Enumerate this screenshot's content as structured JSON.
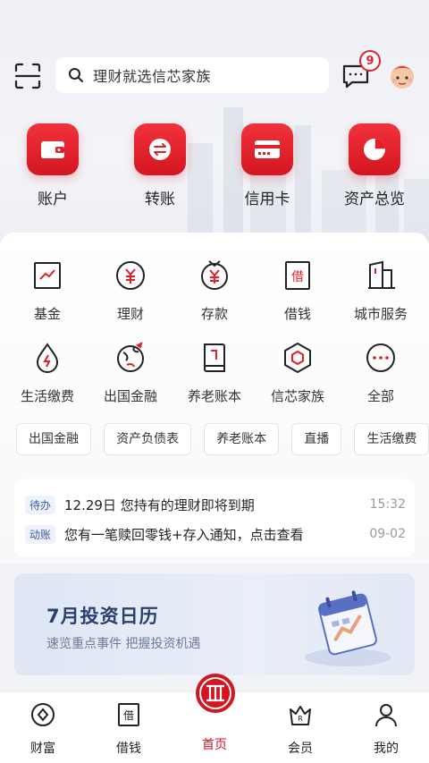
{
  "search": {
    "placeholder": "理财就选信芯家族"
  },
  "notifications": {
    "badge_count": "9"
  },
  "primary_actions": [
    {
      "label": "账户",
      "icon": "wallet-icon"
    },
    {
      "label": "转账",
      "icon": "transfer-icon"
    },
    {
      "label": "信用卡",
      "icon": "credit-card-icon"
    },
    {
      "label": "资产总览",
      "icon": "pie-chart-icon"
    }
  ],
  "services_row1": [
    {
      "label": "基金",
      "icon": "fund-chart-icon"
    },
    {
      "label": "理财",
      "icon": "wealth-yen-icon"
    },
    {
      "label": "存款",
      "icon": "deposit-yen-icon"
    },
    {
      "label": "借钱",
      "icon": "loan-jie-icon"
    },
    {
      "label": "城市服务",
      "icon": "city-building-icon"
    }
  ],
  "services_row2": [
    {
      "label": "生活缴费",
      "icon": "water-drop-icon"
    },
    {
      "label": "出国金融",
      "icon": "globe-plane-icon"
    },
    {
      "label": "养老账本",
      "icon": "pension-book-icon"
    },
    {
      "label": "信芯家族",
      "icon": "hexagon-icon"
    },
    {
      "label": "全部",
      "icon": "more-dots-icon"
    }
  ],
  "chips": [
    "出国金融",
    "资产负债表",
    "养老账本",
    "直播",
    "生活缴费"
  ],
  "notices": [
    {
      "tag": "待办",
      "text": "12.29日 您持有的理财即将到期",
      "time": "15:32"
    },
    {
      "tag": "动账",
      "text": "您有一笔赎回零钱+存入通知，点击查看",
      "time": "09-02"
    }
  ],
  "banner": {
    "title": "7月投资日历",
    "subtitle": "速览重点事件 把握投资机遇"
  },
  "tabbar": [
    {
      "label": "财富",
      "icon": "wealth-coin-icon"
    },
    {
      "label": "借钱",
      "icon": "loan-jie-icon"
    },
    {
      "label": "首页",
      "icon": "citic-logo-icon",
      "active": true
    },
    {
      "label": "会员",
      "icon": "member-crown-icon"
    },
    {
      "label": "我的",
      "icon": "profile-icon"
    }
  ],
  "colors": {
    "brand_red": "#d41620",
    "tag_blue": "#3b5ea8",
    "banner_navy": "#2b3f6c"
  }
}
